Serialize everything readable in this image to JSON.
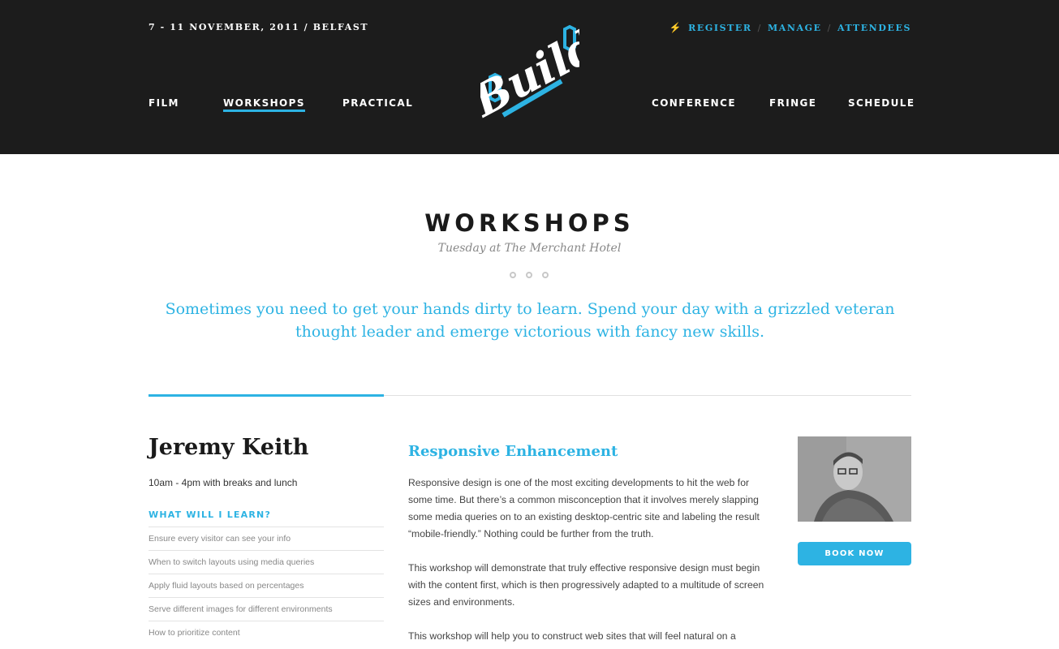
{
  "header": {
    "event_info": "7 - 11 NOVEMBER, 2011 / BELFAST",
    "logo_text": "Build",
    "top_links": [
      {
        "label": "REGISTER"
      },
      {
        "label": "MANAGE"
      },
      {
        "label": "ATTENDEES"
      }
    ],
    "bolt_icon": "lightning-icon",
    "nav_left": [
      {
        "label": "FILM"
      },
      {
        "label": "WORKSHOPS"
      },
      {
        "label": "PRACTICAL"
      }
    ],
    "nav_right": [
      {
        "label": "CONFERENCE"
      },
      {
        "label": "FRINGE"
      },
      {
        "label": "SCHEDULE"
      }
    ],
    "active_nav": "WORKSHOPS"
  },
  "main": {
    "title": "WORKSHOPS",
    "subtitle": "Tuesday at The Merchant Hotel",
    "intro": "Sometimes you need to get your hands dirty to learn. Spend your day with a grizzled veteran thought leader and emerge victorious with fancy new skills."
  },
  "workshop": {
    "speaker_name": "Jeremy Keith",
    "time": "10am - 4pm with breaks and lunch",
    "learn_heading": "WHAT WILL I LEARN?",
    "learn_items": [
      "Ensure every visitor can see your info",
      "When to switch layouts using media queries",
      "Apply fluid layouts based on percentages",
      "Serve different images for different environments",
      "How to prioritize content"
    ],
    "title": "Responsive Enhancement",
    "paragraphs": [
      "Responsive design is one of the most exciting developments to hit the web for some time. But there’s a common misconception that it involves merely slapping some media queries on to an existing desktop-centric site and labeling the result “mobile-friendly.” Nothing could be further from the truth.",
      "This workshop will demonstrate that truly effective responsive design must begin with the content first, which is then progressively adapted to a multitude of screen sizes and environments.",
      "This workshop will help you to construct web sites that will feel natural on a"
    ],
    "book_label": "BOOK NOW"
  },
  "colors": {
    "accent": "#2db3e3",
    "header_bg": "#1c1c1c"
  }
}
